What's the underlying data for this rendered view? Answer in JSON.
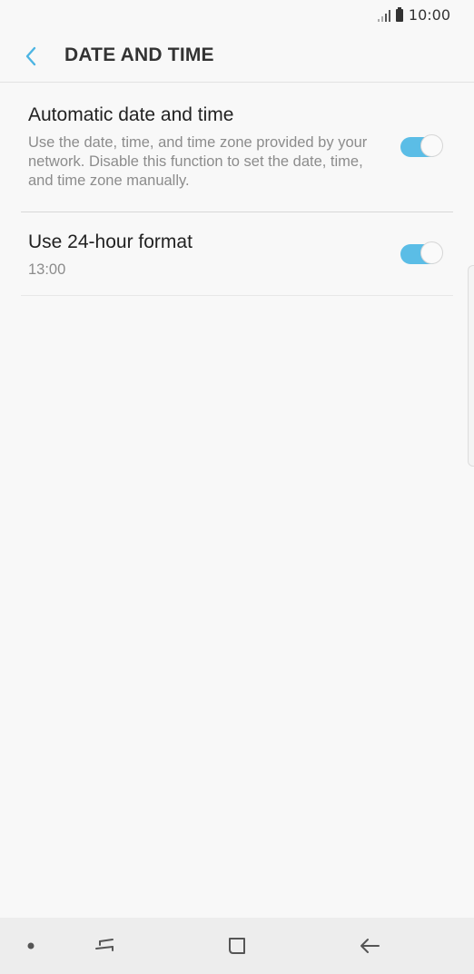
{
  "status_bar": {
    "time": "10:00"
  },
  "header": {
    "title": "DATE AND TIME"
  },
  "settings": [
    {
      "title": "Automatic date and time",
      "description": "Use the date, time, and time zone provided by your network. Disable this function to set the date, time, and time zone manually.",
      "enabled": true
    },
    {
      "title": "Use 24-hour format",
      "description": "13:00",
      "enabled": true
    }
  ],
  "colors": {
    "accent": "#4db5e3",
    "toggle_track": "#5bbde6"
  },
  "nav": [
    "dot-icon",
    "recent-apps-icon",
    "home-icon",
    "back-arrow-icon"
  ]
}
